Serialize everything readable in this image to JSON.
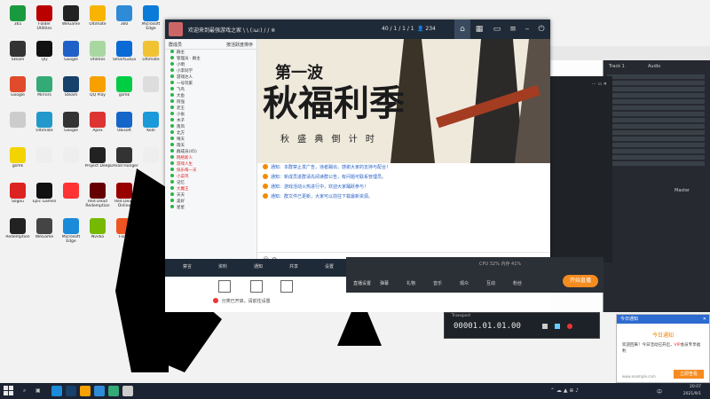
{
  "desktop": {
    "icons": [
      {
        "label": "365",
        "name": "icon-365",
        "color": "#1a9a3e"
      },
      {
        "label": "Folder Utilities",
        "name": "icon-folder",
        "color": "#b00"
      },
      {
        "label": "WeGame",
        "name": "icon-wegame",
        "color": "#222"
      },
      {
        "label": "Ultimate",
        "name": "icon-ultimate",
        "color": "#f8b400"
      },
      {
        "label": "360",
        "name": "icon-360",
        "color": "#2e8bd8"
      },
      {
        "label": "Microsoft Edge",
        "name": "icon-edge",
        "color": "#0a7bd8"
      },
      {
        "label": "Steam",
        "name": "icon-steam",
        "color": "#333"
      },
      {
        "label": "QQ",
        "name": "icon-qq",
        "color": "#111"
      },
      {
        "label": "Google",
        "name": "icon-google",
        "color": "#1f5fc8"
      },
      {
        "label": "Utilities",
        "name": "icon-util",
        "color": "#a8d8a0"
      },
      {
        "label": "SmartGaGa",
        "name": "icon-smartgaga",
        "color": "#0a6ad6"
      },
      {
        "label": "Ultimate",
        "name": "icon-ultimate-2",
        "color": "#f1c232"
      },
      {
        "label": "Google",
        "name": "icon-chrome",
        "color": "#e14a2a"
      },
      {
        "label": "Mirrors",
        "name": "icon-mirrors",
        "color": "#3a7"
      },
      {
        "label": "Steam",
        "name": "icon-steam-2",
        "color": "#17406a"
      },
      {
        "label": "QQ Play",
        "name": "icon-qqplay",
        "color": "#f6a100"
      },
      {
        "label": "gsmk",
        "name": "icon-gsmk",
        "color": "#0c4"
      },
      {
        "label": "",
        "name": "icon-blank",
        "color": "#ddd"
      },
      {
        "label": "",
        "name": "icon-blank-2",
        "color": "#ccc"
      },
      {
        "label": "Ultimate",
        "name": "icon-ultimate-3",
        "color": "#29c"
      },
      {
        "label": "Google",
        "name": "icon-google-2",
        "color": "#333"
      },
      {
        "label": "Apex",
        "name": "icon-apex",
        "color": "#d33"
      },
      {
        "label": "Ubisoft",
        "name": "icon-ubi",
        "color": "#1466c8"
      },
      {
        "label": "Kodi",
        "name": "icon-kodi",
        "color": "#1a9ad8"
      },
      {
        "label": "gsmk",
        "name": "icon-gsmk-2",
        "color": "#f3d400"
      },
      {
        "label": "",
        "name": "icon-page",
        "color": "#eee"
      },
      {
        "label": "",
        "name": "icon-page-2",
        "color": "#eee"
      },
      {
        "label": "Project Deep",
        "name": "icon-project",
        "color": "#222"
      },
      {
        "label": "Dread Hunger",
        "name": "icon-dread",
        "color": "#333"
      },
      {
        "label": "",
        "name": "icon-page-3",
        "color": "#eee"
      },
      {
        "label": "Sogou",
        "name": "icon-sogou",
        "color": "#d22"
      },
      {
        "label": "Epic Games",
        "name": "icon-epic",
        "color": "#111"
      },
      {
        "label": "",
        "name": "icon-gamepad",
        "color": "#f33"
      },
      {
        "label": "Red Dead Redemption",
        "name": "icon-rdr",
        "color": "#600"
      },
      {
        "label": "Red Dead Online",
        "name": "icon-rdo",
        "color": "#900"
      },
      {
        "label": "Rockstar",
        "name": "icon-rockstar",
        "color": "#f4a300"
      },
      {
        "label": "Redemption",
        "name": "icon-redemption",
        "color": "#222"
      },
      {
        "label": "WeGame",
        "name": "icon-wegame-2",
        "color": "#444"
      },
      {
        "label": "Microsoft Edge",
        "name": "icon-edge-2",
        "color": "#1b8ad8"
      },
      {
        "label": "Nvidia",
        "name": "icon-nvidia",
        "color": "#76b900"
      },
      {
        "label": "Forza",
        "name": "icon-forza",
        "color": "#e52"
      }
    ]
  },
  "chat": {
    "title": "欢迎来到最强游戏之家 \\ \\ (:ω:) / / ※",
    "members": "40 / 1 / 1 / 1",
    "online": "234",
    "member_header": "群成员",
    "member_sort": "按活跃度排序",
    "members_list": [
      {
        "name": "群主",
        "red": false
      },
      {
        "name": "管理员 · 群主",
        "red": false
      },
      {
        "name": "小明",
        "red": false
      },
      {
        "name": "小李同学",
        "red": false
      },
      {
        "name": "游戏达人",
        "red": false
      },
      {
        "name": "一号玩家",
        "red": false
      },
      {
        "name": "飞鸟",
        "red": false
      },
      {
        "name": "大鱼",
        "red": false
      },
      {
        "name": "阿强",
        "red": false
      },
      {
        "name": "老王",
        "red": false
      },
      {
        "name": "小张",
        "red": false
      },
      {
        "name": "木子",
        "red": false
      },
      {
        "name": "南风",
        "red": false
      },
      {
        "name": "北方",
        "red": false
      },
      {
        "name": "晴天",
        "red": false
      },
      {
        "name": "雨天",
        "red": false
      },
      {
        "name": "群成员(45)",
        "red": false
      },
      {
        "name": "网络新人",
        "red": true
      },
      {
        "name": "游戏人生",
        "red": true
      },
      {
        "name": "快乐每一天",
        "red": true
      },
      {
        "name": "小菜鸡",
        "red": true
      },
      {
        "name": "记忆",
        "red": false
      },
      {
        "name": "大魔王",
        "red": true
      },
      {
        "name": "天天",
        "red": false
      },
      {
        "name": "美好",
        "red": false
      },
      {
        "name": "星星",
        "red": false
      }
    ],
    "banner": {
      "small": "第一波",
      "big": "秋福利季",
      "sub": "秋 盛 典 倒 计 时"
    },
    "messages": [
      "通知：本群禁止发广告，违者踢出，感谢大家的支持与配合！",
      "通知：新成员进群请先阅读群公告，有问题可联系管理员。",
      "通知：游戏活动火热进行中，欢迎大家踊跃参与！",
      "通知：群文件已更新，大家可以前往下载最新资源。"
    ],
    "send_label": "发送",
    "toolbar": [
      "禁言",
      "资料",
      "通知",
      "共享",
      "设置"
    ]
  },
  "stream": {
    "items": [
      "直播设置",
      "弹幕",
      "礼物",
      "音乐",
      "观众",
      "互动",
      "粉丝"
    ],
    "start": "开始直播",
    "status": "CPU 32%   内存 41%"
  },
  "notice": {
    "text": "分类已开启，请前往设置"
  },
  "daw": {
    "labels": [
      "Track 1",
      "Audio",
      "Master"
    ]
  },
  "transport": {
    "counter": "00001.01.01.00",
    "label": "Transport"
  },
  "popup": {
    "header": "今日通知",
    "title": "今日通知",
    "body_pre": "欢迎回来！今日活动已开启，",
    "vip": "VIP",
    "body_post": "会员专享福利",
    "button": "立即查看",
    "site": "www.example.com"
  },
  "taskbar": {
    "time": "20:07",
    "date": "2021/9/1"
  }
}
